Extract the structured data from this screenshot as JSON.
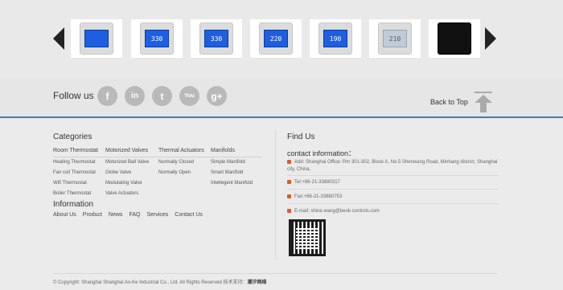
{
  "carousel": {
    "products": [
      {
        "screen": "",
        "style": "blue"
      },
      {
        "screen": "330",
        "style": "blue"
      },
      {
        "screen": "330",
        "style": "blue"
      },
      {
        "screen": "220",
        "style": "blue"
      },
      {
        "screen": "190",
        "style": "blue"
      },
      {
        "screen": "210",
        "style": "grey"
      },
      {
        "screen": "",
        "style": "dark"
      }
    ]
  },
  "follow": {
    "label": "Follow us",
    "socials": [
      {
        "name": "facebook",
        "glyph": "f"
      },
      {
        "name": "linkedin",
        "glyph": "in"
      },
      {
        "name": "twitter",
        "glyph": "t"
      },
      {
        "name": "youtube",
        "glyph": "You"
      },
      {
        "name": "googleplus",
        "glyph": "g+"
      }
    ],
    "back_to_top": "Back to Top"
  },
  "categories": {
    "title": "Categories",
    "columns": [
      {
        "head": "Room Thermostat",
        "links": [
          "Heating Thermostat",
          "Fan coil Thermostat",
          "Wifi Thermostat",
          "Boiler Thermostat"
        ]
      },
      {
        "head": "Motorized Valves",
        "links": [
          "Motorized Ball Valve",
          "Globe Valve",
          "Modulating Valve",
          "Valve Actuators"
        ]
      },
      {
        "head": "Thermal Actuators",
        "links": [
          "Normally Closed",
          "Normally Open"
        ]
      },
      {
        "head": "Manifolds",
        "links": [
          "Simple Manifold",
          "Smart Manifold",
          "Intellegent Manifold"
        ]
      }
    ]
  },
  "information": {
    "title": "Information",
    "links": [
      "About Us",
      "Product",
      "News",
      "FAQ",
      "Services",
      "Contact Us"
    ]
  },
  "find_us": {
    "title": "Find Us",
    "contact_title": "contact information：",
    "address": "Add: Shanghai Office: Rm 301-302, Block A, No.5 Shenwang Road, Minhang district, Shanghai city, China.",
    "tel": "Tel:+86-21-33880317",
    "fax": "Fax:+86-21-33880753",
    "email_label": "E-mail:",
    "email": "shine.wang@beok-controls.com"
  },
  "copyright": {
    "text": "© Copyright: Shanghai Shanghai Ao-Ke Industrial Co., Ltd. All Rights Reserved 技术支持：",
    "support": "潮汐网络"
  }
}
